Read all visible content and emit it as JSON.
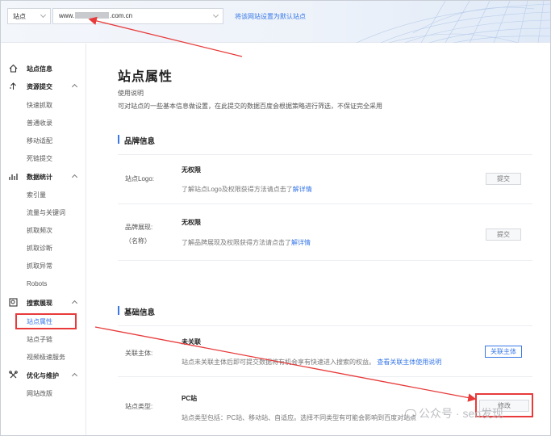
{
  "topbar": {
    "site_select": "站点",
    "url_prefix": "www.",
    "url_suffix": ".com.cn",
    "default_link": "将该网站设置为默认站点"
  },
  "sidebar": {
    "sections": [
      {
        "label": "站点信息",
        "icon": "home-icon",
        "items": []
      },
      {
        "label": "资源提交",
        "icon": "upload-icon",
        "items": [
          "快速抓取",
          "普通收录",
          "移动适配",
          "死链提交"
        ]
      },
      {
        "label": "数据统计",
        "icon": "bar-chart-icon",
        "items": [
          "索引量",
          "流量与关键词",
          "抓取频次",
          "抓取诊断",
          "抓取异常",
          "Robots"
        ]
      },
      {
        "label": "搜索展现",
        "icon": "search-display-icon",
        "items": [
          "站点属性",
          "站点子链",
          "视频极速服务"
        ]
      },
      {
        "label": "优化与维护",
        "icon": "tools-icon",
        "items": [
          "网站改版"
        ]
      }
    ],
    "active_item": "站点属性"
  },
  "main": {
    "title": "站点属性",
    "usage_label": "使用说明",
    "usage_text": "可对站点的一些基本信息做设置，在此提交的数据百度会根据策略进行筛选，不保证完全采用",
    "brand": {
      "heading": "品牌信息",
      "logo_label": "站点Logo:",
      "logo_status": "无权限",
      "logo_desc": "了解站点Logo及权限获得方法请点击了",
      "logo_link": "解详情",
      "logo_button": "提交",
      "name_label": "品牌展现:",
      "name_sub": "（名称）",
      "name_status": "无权限",
      "name_desc": "了解品牌展现及权限获得方法请点击了",
      "name_link": "解详情",
      "name_button": "提交"
    },
    "basic": {
      "heading": "基础信息",
      "entity_label": "关联主体:",
      "entity_status": "未关联",
      "entity_desc": "站点未关联主体后即可提交数据将有机会享有快速进入搜索的权益。",
      "entity_link": "查看关联主体使用说明",
      "entity_button": "关联主体",
      "type_label": "站点类型:",
      "type_value": "PC站",
      "type_desc": "站点类型包括：PC站、移动站、自适应。选择不同类型有可能会影响到百度对站点",
      "type_button": "修改"
    }
  },
  "watermark": "公众号 · seo发现",
  "colors": {
    "accent": "#3878e8",
    "annotation": "#e83a3a"
  }
}
